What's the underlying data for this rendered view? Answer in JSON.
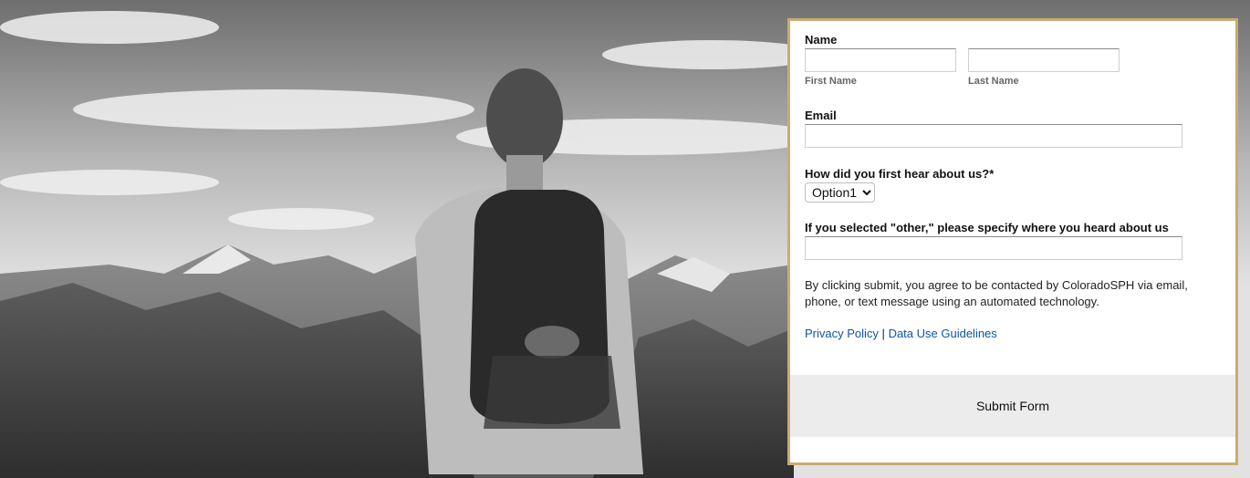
{
  "background": {
    "image_name": "hiker-with-backpack-mountains-photo"
  },
  "form": {
    "name_label": "Name",
    "first_name": {
      "value": "",
      "sublabel": "First Name"
    },
    "last_name": {
      "value": "",
      "sublabel": "Last Name"
    },
    "email_label": "Email",
    "email_value": "",
    "hear_label": "How did you first hear about us?*",
    "hear_selected": "Option1",
    "other_label": "If you selected \"other,\" please specify where you heard about us",
    "other_value": "",
    "consent_text": "By clicking submit, you agree to be contacted by ColoradoSPH via email, phone, or text message using an automated technology.",
    "privacy_link": "Privacy Policy",
    "separator": "|",
    "data_use_link": "Data Use Guidelines",
    "submit_label": "Submit Form"
  },
  "colors": {
    "panel_border": "#c9ac72",
    "link": "#0b56a8",
    "submit_bg": "#ececec"
  }
}
